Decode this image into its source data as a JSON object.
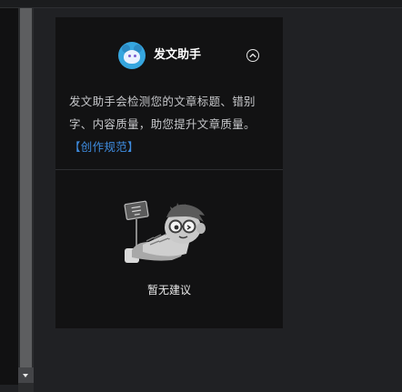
{
  "assistant": {
    "title": "发文助手",
    "description": "发文助手会检测您的文章标题、错别字、内容质量，助您提升文章质量。",
    "guide_link": "【创作规范】",
    "empty_state": "暂无建议"
  },
  "icons": {
    "logo": "assistant-mascot-icon",
    "collapse": "chevron-up-circle-icon",
    "scroll_down": "triangle-down-icon"
  },
  "colors": {
    "panel_bg": "#121213",
    "page_bg": "#202124",
    "link": "#3e8ce0",
    "logo_bg": "#36a6df"
  }
}
